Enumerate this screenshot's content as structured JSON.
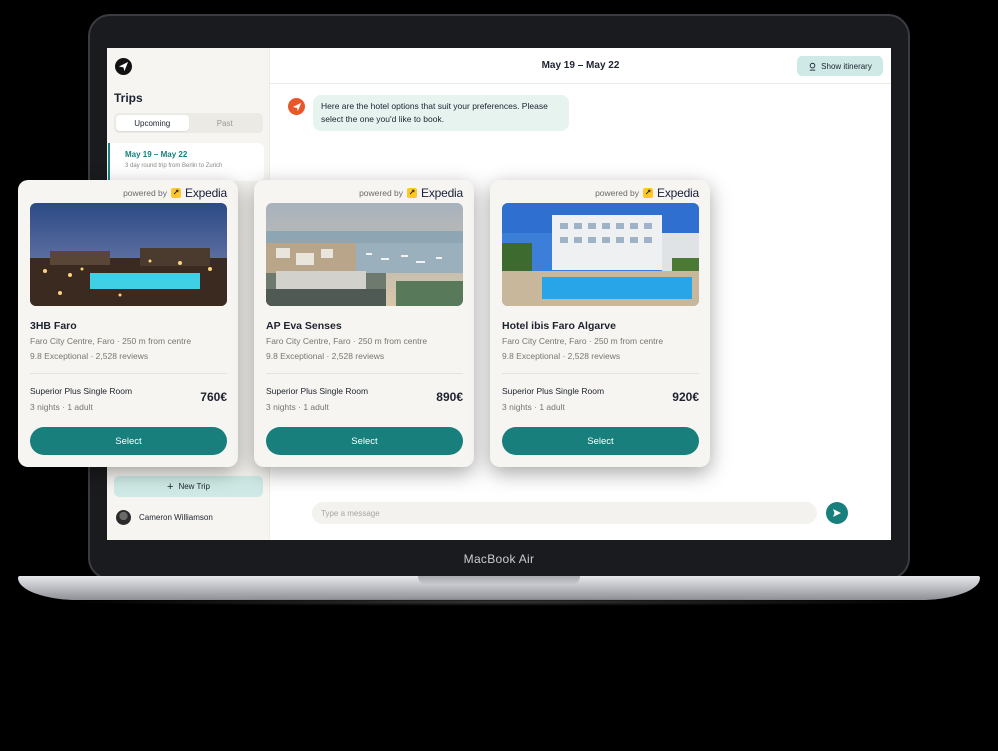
{
  "device": {
    "label": "MacBook Air"
  },
  "sidebar": {
    "title": "Trips",
    "tabs": [
      {
        "label": "Upcoming",
        "active": true
      },
      {
        "label": "Past",
        "active": false
      }
    ],
    "trip": {
      "dates": "May 19 – May 22",
      "description": "3 day round trip from Berlin to Zurich"
    },
    "new_trip_label": "New Trip",
    "user_name": "Cameron Williamson"
  },
  "header": {
    "date_range": "May 19 – May 22",
    "itinerary_button": "Show itinerary"
  },
  "chat": {
    "message": "Here are the hotel options that suit your preferences. Please select the one you'd like to book.",
    "input_placeholder": "Type a message"
  },
  "provider": {
    "prefix": "powered by",
    "name": "Expedia"
  },
  "hotels": [
    {
      "name": "3HB Faro",
      "location": "Faro City Centre, Faro · 250 m from centre",
      "rating": "9.8 Exceptional · 2,528 reviews",
      "room": "Superior Plus Single Room",
      "stay": "3 nights · 1 adult",
      "price": "760€",
      "select_label": "Select"
    },
    {
      "name": "AP Eva Senses",
      "location": "Faro City Centre, Faro · 250 m from centre",
      "rating": "9.8 Exceptional · 2,528 reviews",
      "room": "Superior Plus Single Room",
      "stay": "3 nights · 1 adult",
      "price": "890€",
      "select_label": "Select"
    },
    {
      "name": "Hotel ibis Faro Algarve",
      "location": "Faro City Centre, Faro · 250 m from centre",
      "rating": "9.8 Exceptional · 2,528 reviews",
      "room": "Superior Plus Single Room",
      "stay": "3 nights · 1 adult",
      "price": "920€",
      "select_label": "Select"
    }
  ],
  "colors": {
    "accent": "#187f7d",
    "accent_light": "#cfeae6",
    "bot": "#e8572a",
    "expedia_yellow": "#ffc72c"
  }
}
